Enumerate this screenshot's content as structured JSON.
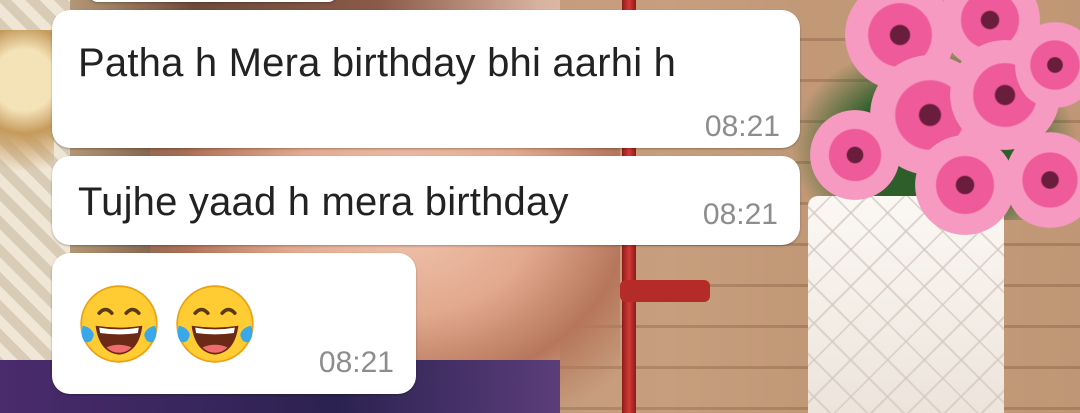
{
  "messages": [
    {
      "text": "Patha h Mera birthday bhi aarhi h",
      "time": "08:21"
    },
    {
      "text": "Tujhe yaad h mera birthday",
      "time": "08:21"
    },
    {
      "emojis": [
        "face-with-tears-of-joy-icon",
        "face-with-tears-of-joy-icon"
      ],
      "time": "08:21"
    }
  ],
  "colors": {
    "bubble": "#ffffff",
    "text": "#222222",
    "timestamp": "#8d8d8d"
  }
}
